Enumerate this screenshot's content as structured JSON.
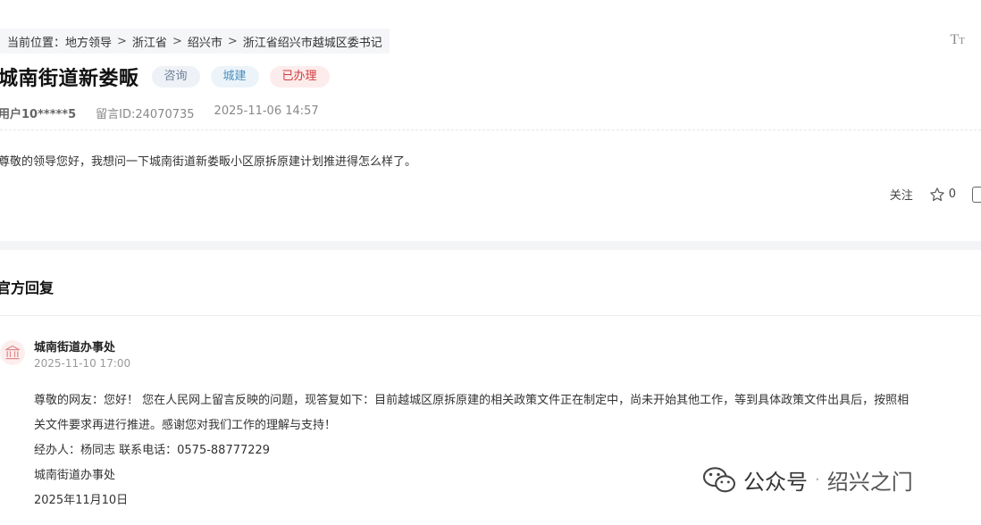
{
  "breadcrumb": {
    "items": [
      "当前位置：地方领导",
      "浙江省",
      "绍兴市",
      "浙江省绍兴市越城区委书记"
    ],
    "separator": ">"
  },
  "font_size_button": {
    "label_big": "T",
    "label_small": "T"
  },
  "post": {
    "title": "城南街道新娄畈",
    "tags": [
      "咨询",
      "城建",
      "已办理"
    ],
    "user": "用户10*****5",
    "message_id": "留言ID:24070735",
    "datetime": "2025-11-06 14:57",
    "content": "尊敬的领导您好，我想问一下城南街道新娄畈小区原拆原建计划推进得怎么样了。"
  },
  "actions": {
    "follow_label": "关注",
    "star_count": "0"
  },
  "reply": {
    "section_title": "官方回复",
    "org_name": "城南街道办事处",
    "time": "2025-11-10 17:00",
    "lines": [
      "尊敬的网友：您好！  您在人民网上留言反映的问题，现答复如下：目前越城区原拆原建的相关政策文件正在制定中，尚未开始其他工作，等到具体政策文件出具后，按照相",
      "关文件要求再进行推进。感谢您对我们工作的理解与支持！",
      "经办人：杨同志    联系电话：0575-88777229",
      "城南街道办事处",
      "2025年11月10日"
    ]
  },
  "watermark": {
    "platform": "公众号",
    "separator": "·",
    "account": "绍兴之门"
  },
  "colors": {
    "done_tag": "#d23b3b",
    "city_tag": "#4a8fc0",
    "consult_tag": "#6f8097"
  }
}
